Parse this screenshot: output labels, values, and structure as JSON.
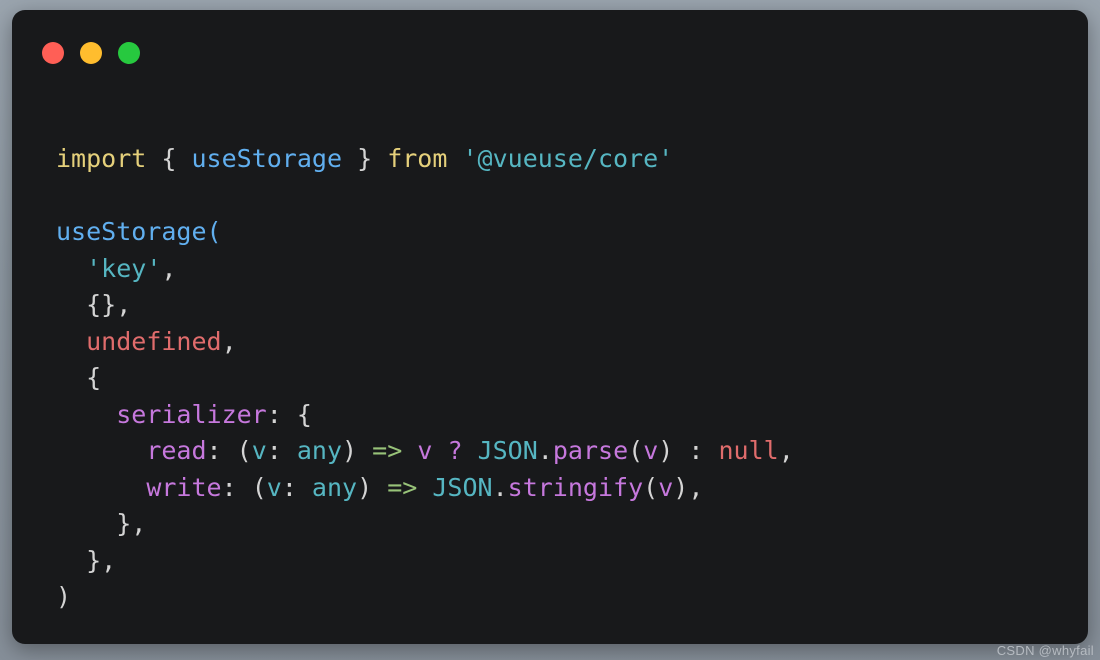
{
  "window": {
    "dots": [
      {
        "name": "close",
        "color": "#ff5f56"
      },
      {
        "name": "minimize",
        "color": "#ffbd2e"
      },
      {
        "name": "maximize",
        "color": "#27c93f"
      }
    ]
  },
  "theme": {
    "page_background": "#8e99a3",
    "card_background": "#18191b",
    "keyword": "#e5d07b",
    "identifier": "#61afef",
    "string": "#56b6c2",
    "literal": "#e06c6c",
    "property": "#c678dd",
    "type": "#56b6c2",
    "arrow": "#98c379",
    "punctuation": "#d4d4d4"
  },
  "code": {
    "language": "typescript",
    "full_text": "import { useStorage } from '@vueuse/core'\n\nuseStorage(\n  'key',\n  {},\n  undefined,\n  {\n    serializer: {\n      read: (v: any) => v ? JSON.parse(v) : null,\n      write: (v: any) => JSON.stringify(v),\n    },\n  },\n)",
    "lines": [
      {
        "index": 1,
        "tokens": [
          {
            "text": "import",
            "type": "keyword"
          },
          {
            "text": " ",
            "type": "plain"
          },
          {
            "text": "{",
            "type": "punct"
          },
          {
            "text": " ",
            "type": "plain"
          },
          {
            "text": "useStorage",
            "type": "ident"
          },
          {
            "text": " ",
            "type": "plain"
          },
          {
            "text": "}",
            "type": "punct"
          },
          {
            "text": " ",
            "type": "plain"
          },
          {
            "text": "from",
            "type": "keyword"
          },
          {
            "text": " ",
            "type": "plain"
          },
          {
            "text": "'@vueuse/core'",
            "type": "string"
          }
        ]
      },
      {
        "index": 2,
        "tokens": []
      },
      {
        "index": 3,
        "tokens": [
          {
            "text": "useStorage",
            "type": "ident"
          },
          {
            "text": "(",
            "type": "ident"
          }
        ]
      },
      {
        "index": 4,
        "tokens": [
          {
            "text": "  ",
            "type": "plain"
          },
          {
            "text": "'key'",
            "type": "string"
          },
          {
            "text": ",",
            "type": "punct"
          }
        ]
      },
      {
        "index": 5,
        "tokens": [
          {
            "text": "  ",
            "type": "plain"
          },
          {
            "text": "{},",
            "type": "punct"
          }
        ]
      },
      {
        "index": 6,
        "tokens": [
          {
            "text": "  ",
            "type": "plain"
          },
          {
            "text": "undefined",
            "type": "literal"
          },
          {
            "text": ",",
            "type": "punct"
          }
        ]
      },
      {
        "index": 7,
        "tokens": [
          {
            "text": "  ",
            "type": "plain"
          },
          {
            "text": "{",
            "type": "punct"
          }
        ]
      },
      {
        "index": 8,
        "tokens": [
          {
            "text": "    ",
            "type": "plain"
          },
          {
            "text": "serializer",
            "type": "prop"
          },
          {
            "text": ": {",
            "type": "punct"
          }
        ]
      },
      {
        "index": 9,
        "tokens": [
          {
            "text": "      ",
            "type": "plain"
          },
          {
            "text": "read",
            "type": "prop"
          },
          {
            "text": ": ",
            "type": "punct"
          },
          {
            "text": "(",
            "type": "punct"
          },
          {
            "text": "v",
            "type": "type"
          },
          {
            "text": ": ",
            "type": "punct"
          },
          {
            "text": "any",
            "type": "type"
          },
          {
            "text": ")",
            "type": "punct"
          },
          {
            "text": " ",
            "type": "plain"
          },
          {
            "text": "=>",
            "type": "arrow"
          },
          {
            "text": " ",
            "type": "plain"
          },
          {
            "text": "v",
            "type": "prop"
          },
          {
            "text": " ",
            "type": "plain"
          },
          {
            "text": "?",
            "type": "prop"
          },
          {
            "text": " ",
            "type": "plain"
          },
          {
            "text": "JSON",
            "type": "type"
          },
          {
            "text": ".",
            "type": "punct"
          },
          {
            "text": "parse",
            "type": "prop"
          },
          {
            "text": "(",
            "type": "punct"
          },
          {
            "text": "v",
            "type": "prop"
          },
          {
            "text": ")",
            "type": "punct"
          },
          {
            "text": " : ",
            "type": "punct"
          },
          {
            "text": "null",
            "type": "literal"
          },
          {
            "text": ",",
            "type": "punct"
          }
        ]
      },
      {
        "index": 10,
        "tokens": [
          {
            "text": "      ",
            "type": "plain"
          },
          {
            "text": "write",
            "type": "prop"
          },
          {
            "text": ": ",
            "type": "punct"
          },
          {
            "text": "(",
            "type": "punct"
          },
          {
            "text": "v",
            "type": "type"
          },
          {
            "text": ": ",
            "type": "punct"
          },
          {
            "text": "any",
            "type": "type"
          },
          {
            "text": ")",
            "type": "punct"
          },
          {
            "text": " ",
            "type": "plain"
          },
          {
            "text": "=>",
            "type": "arrow"
          },
          {
            "text": " ",
            "type": "plain"
          },
          {
            "text": "JSON",
            "type": "type"
          },
          {
            "text": ".",
            "type": "punct"
          },
          {
            "text": "stringify",
            "type": "prop"
          },
          {
            "text": "(",
            "type": "punct"
          },
          {
            "text": "v",
            "type": "prop"
          },
          {
            "text": ")",
            "type": "punct"
          },
          {
            "text": ",",
            "type": "punct"
          }
        ]
      },
      {
        "index": 11,
        "tokens": [
          {
            "text": "    ",
            "type": "plain"
          },
          {
            "text": "},",
            "type": "punct"
          }
        ]
      },
      {
        "index": 12,
        "tokens": [
          {
            "text": "  ",
            "type": "plain"
          },
          {
            "text": "},",
            "type": "punct"
          }
        ]
      },
      {
        "index": 13,
        "tokens": [
          {
            "text": ")",
            "type": "punct"
          }
        ]
      }
    ]
  },
  "watermark": {
    "text": "CSDN @whyfail"
  }
}
